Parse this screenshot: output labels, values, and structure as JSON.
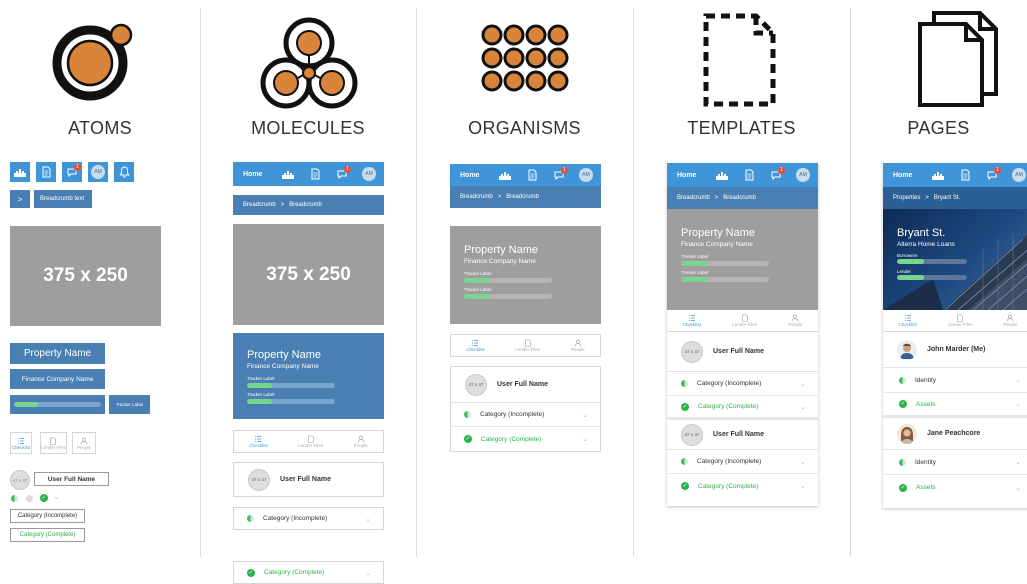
{
  "columns": [
    {
      "title": "ATOMS"
    },
    {
      "title": "MOLECULES"
    },
    {
      "title": "ORGANISMS"
    },
    {
      "title": "TEMPLATES"
    },
    {
      "title": "PAGES"
    }
  ],
  "ui": {
    "home": "Home",
    "badge": "1",
    "avatar_initials": "AM",
    "breadcrumb_text": "Breadcrumb text",
    "breadcrumb_chevron": ">",
    "breadcrumb_a": "Breadcrumb",
    "breadcrumb_b": "Breadcrumb",
    "placeholder": "375 x 250",
    "property_name": "Property Name",
    "finance_company": "Finance Company Name",
    "tracker_label": "Tracker Label",
    "tab_checklist": "Checklist",
    "tab_lender_files": "Lender Files",
    "tab_people": "People",
    "avatar_placeholder": "47 x 47",
    "user_full_name": "User Full Name",
    "category_incomplete": "Category (Incomplete)",
    "category_complete": "Category (Complete)"
  },
  "pages": {
    "breadcrumb_a": "Properties",
    "breadcrumb_b": "Bryant St.",
    "property": "Bryant St.",
    "lender": "Alterra Home Loans",
    "label_borrowers": "Borrowers",
    "label_lender": "Lender",
    "person_1": "John Marder (Me)",
    "person_2": "Jane Peachcore",
    "item_identity": "Identity",
    "item_assets": "Assets"
  },
  "colors": {
    "accent": "#3f95d8",
    "secondary": "#4a7fb3",
    "icon_orange": "#d8843a",
    "placeholder_grey": "#9e9e9e",
    "success": "#2cb14a"
  }
}
